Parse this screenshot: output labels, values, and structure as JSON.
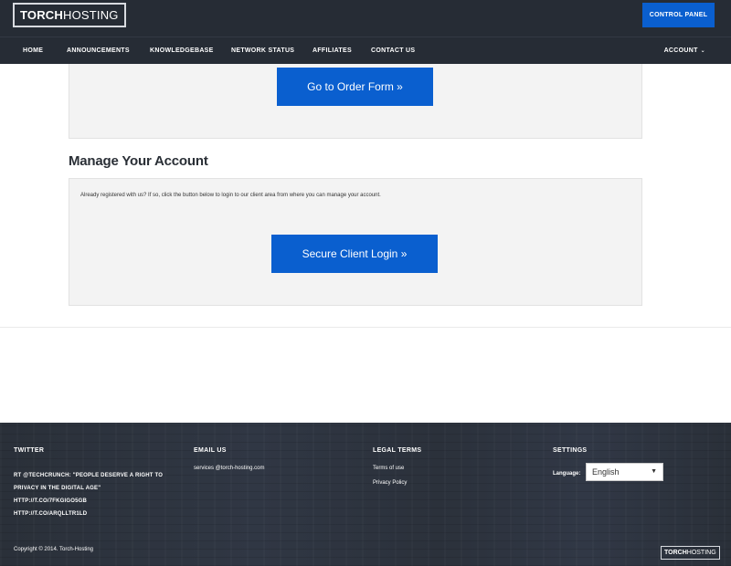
{
  "header": {
    "logo_part1": "TORCH",
    "logo_part2": "HOSTING",
    "control_panel_label": "CONTROL PANEL",
    "accent_color": "#0a5fcf",
    "bg_color": "#262c35"
  },
  "nav": {
    "items": [
      {
        "label": "HOME"
      },
      {
        "label": "ANNOUNCEMENTS"
      },
      {
        "label": "KNOWLEDGEBASE"
      },
      {
        "label": "NETWORK STATUS"
      },
      {
        "label": "AFFILIATES"
      },
      {
        "label": "CONTACT US"
      }
    ],
    "account_label": "ACCOUNT",
    "account_icon": "chevron-down-icon"
  },
  "main": {
    "order_button_label": "Go to Order Form »",
    "manage_title": "Manage Your Account",
    "manage_text": "Already registered with us? If so, click the button below to login to our client area from where you can manage your account.",
    "login_button_label": "Secure Client Login »"
  },
  "footer": {
    "twitter": {
      "title": "TWITTER",
      "line1": "RT @TECHCRUNCH: \"PEOPLE DESERVE A RIGHT TO",
      "line2": "PRIVACY IN THE DIGITAL AGE\"",
      "link1": "HTTP://T.CO/7FKGIGO5GB",
      "link2": "HTTP://T.CO/ARQLLTR1LD"
    },
    "email": {
      "title": "EMAIL US",
      "address": "services @torch-hosting.com"
    },
    "legal": {
      "title": "LEGAL TERMS",
      "terms": "Terms of use",
      "privacy": "Privacy Policy"
    },
    "settings": {
      "title": "SETTINGS",
      "language_label": "Language:",
      "language_value": "English"
    },
    "copyright": "Copyright © 2014. Torch-Hosting",
    "logo_part1": "TORCH",
    "logo_part2": "HOSTING"
  }
}
